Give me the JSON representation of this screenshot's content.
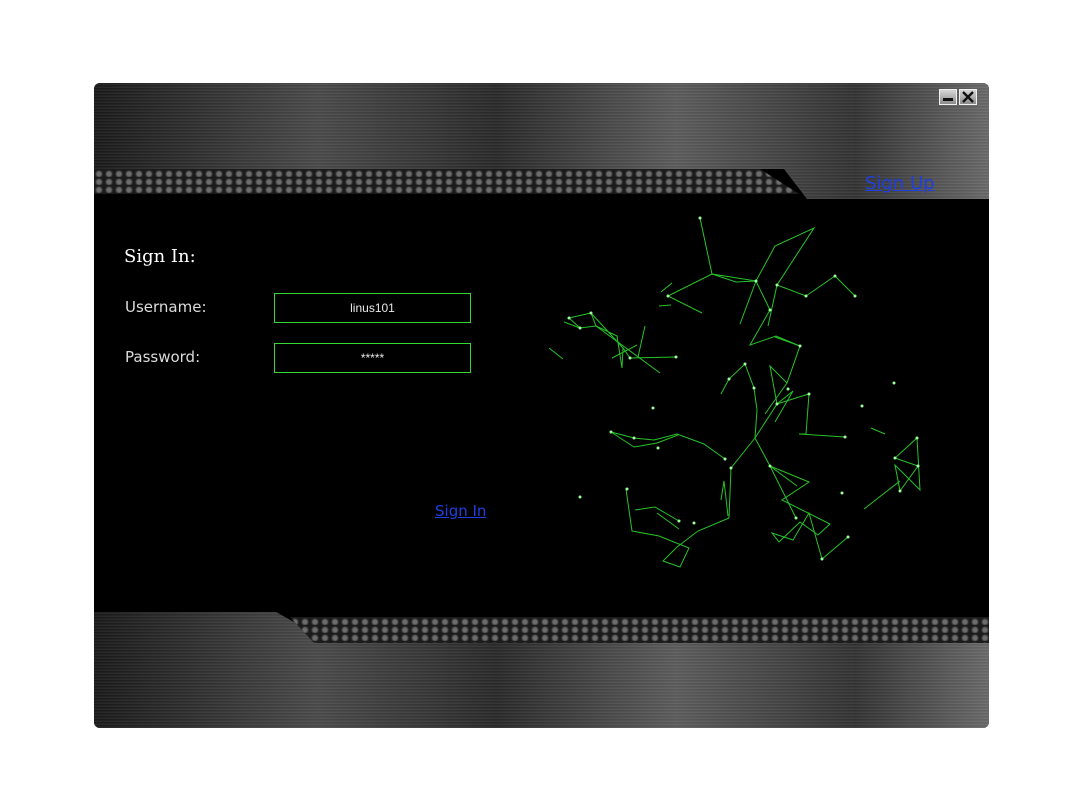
{
  "window": {
    "controls": {
      "minimize_icon": "minimize-icon",
      "close_icon": "close-icon"
    },
    "signup_link": "Sign Up"
  },
  "form": {
    "heading": "Sign In:",
    "username_label": "Username:",
    "username_value": "linus101",
    "password_label": "Password:",
    "password_value": "*****",
    "submit_link": "Sign In"
  },
  "decoration": {
    "network_icon": "network-graph-icon",
    "accent_color": "#2ee62e"
  }
}
